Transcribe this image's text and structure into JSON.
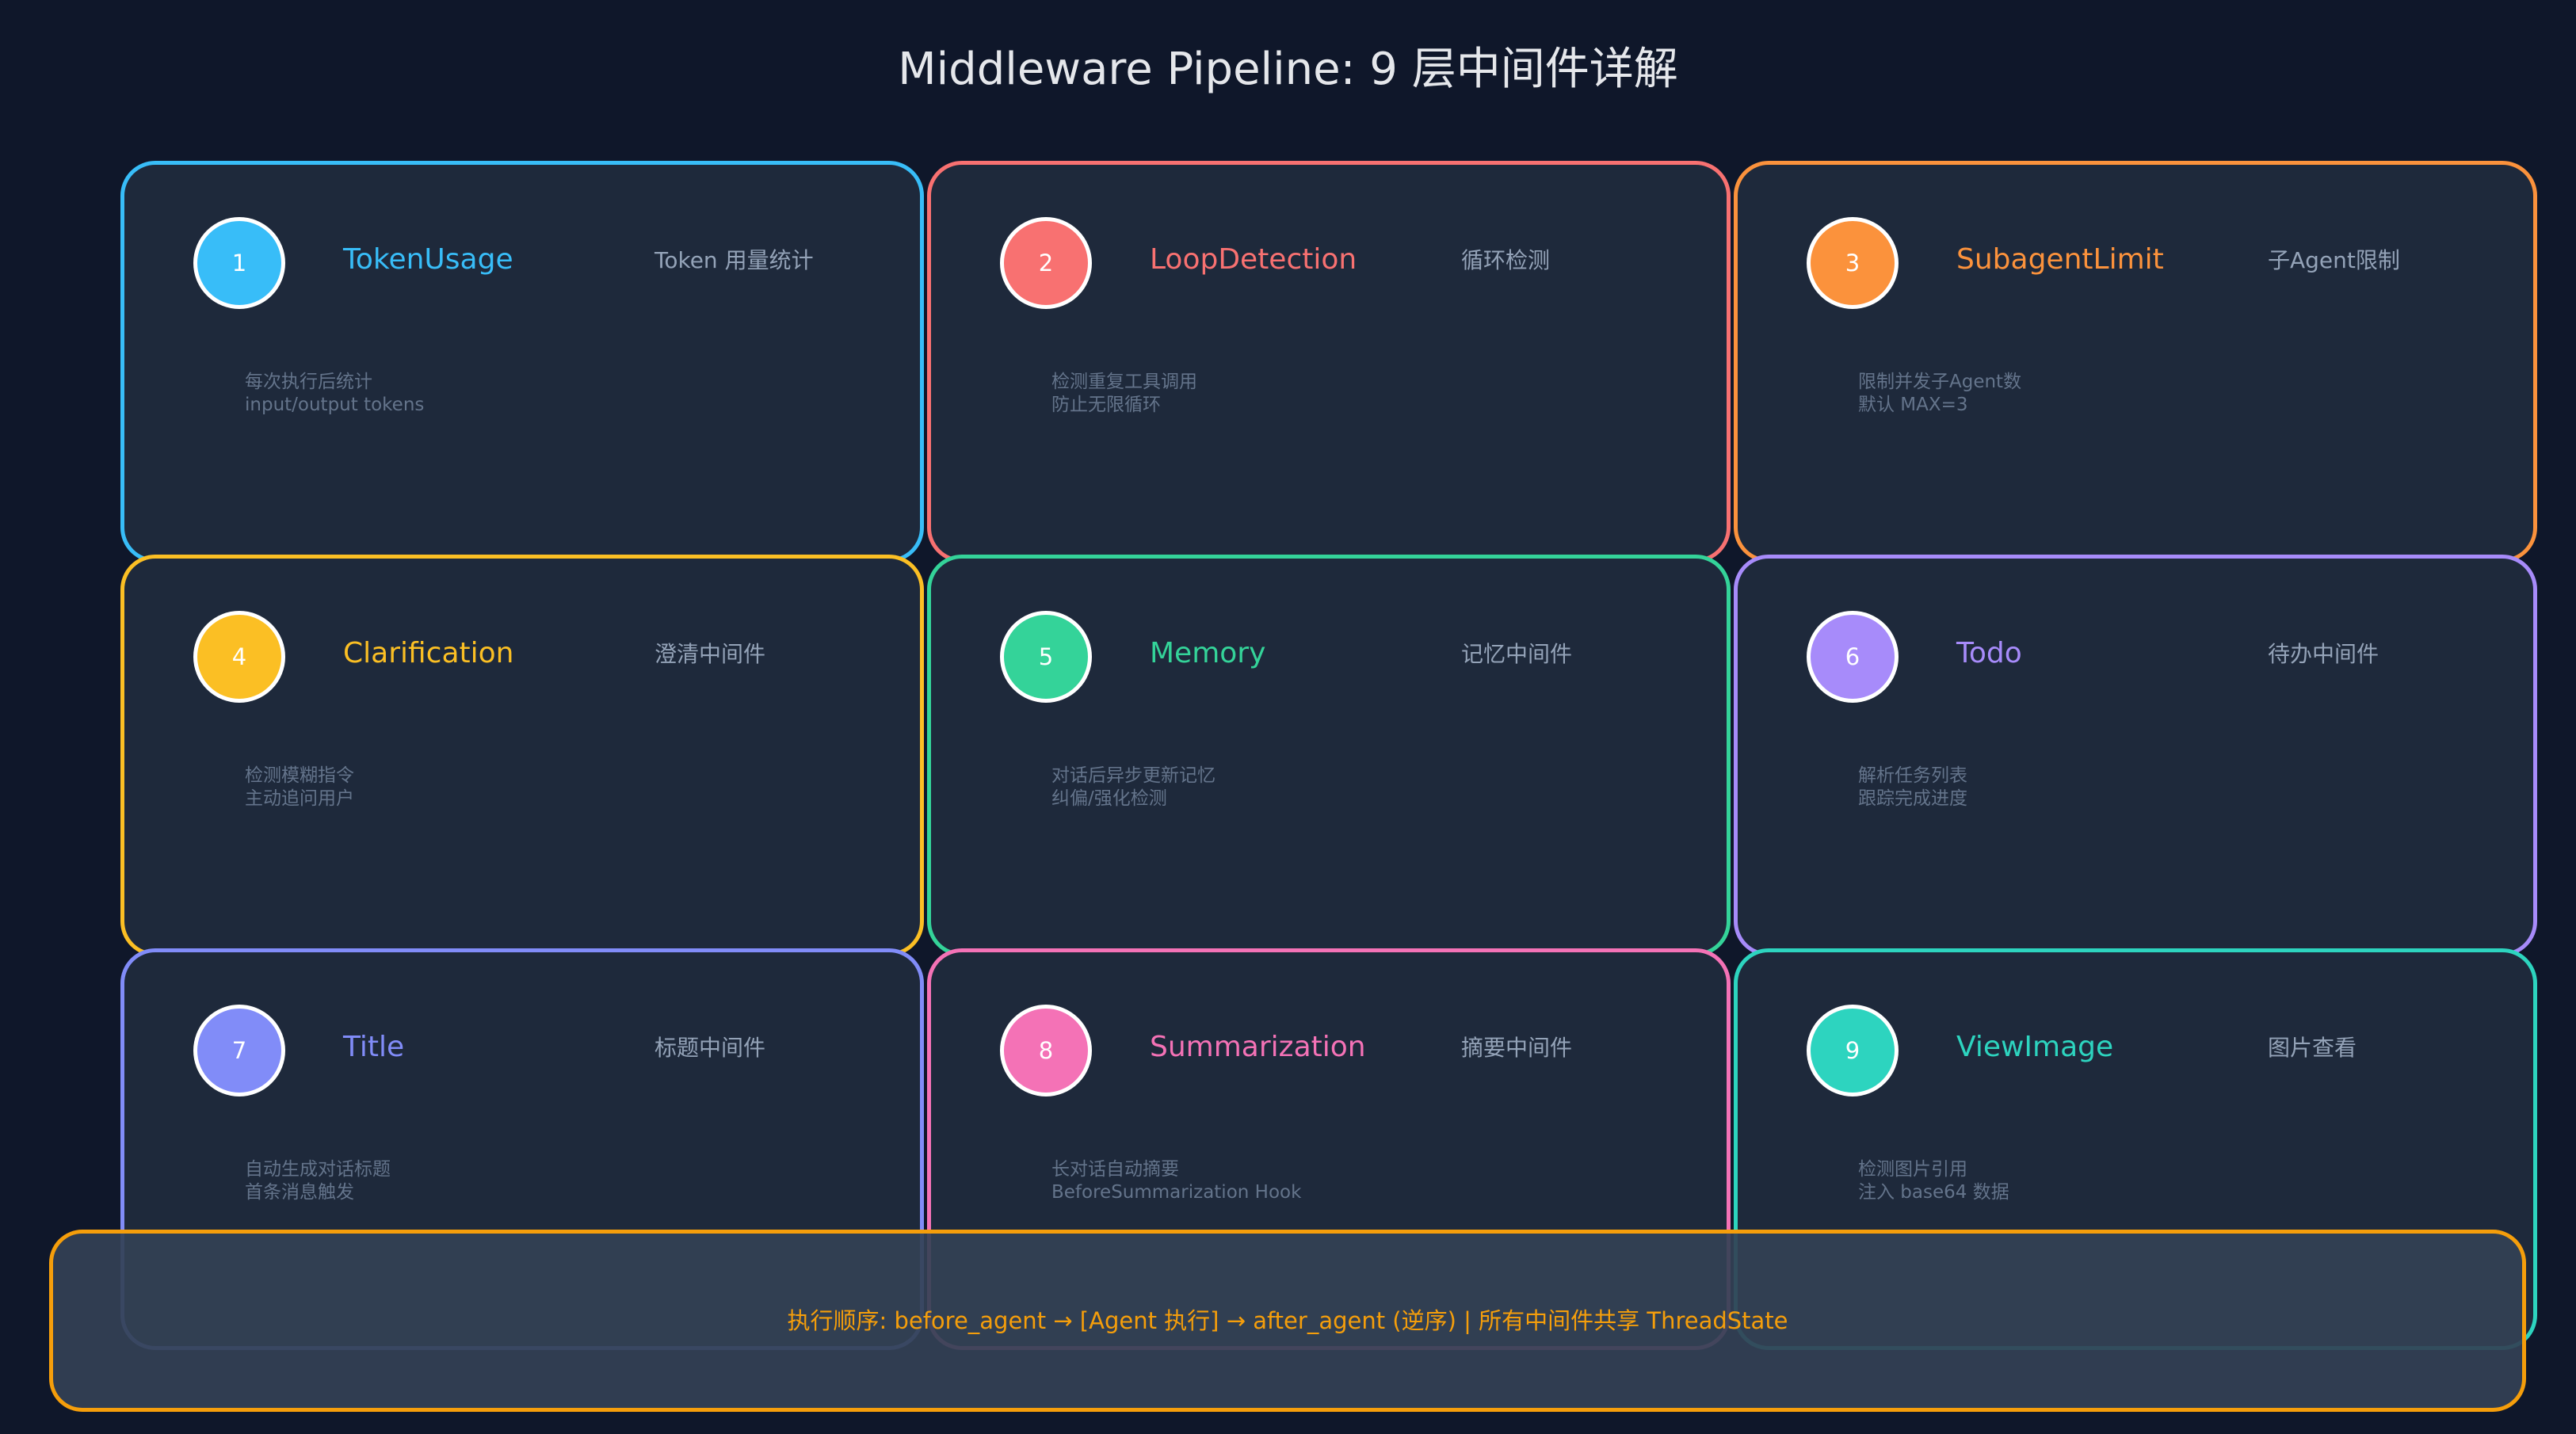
{
  "title": "Middleware Pipeline: 9 层中间件详解",
  "cards": [
    {
      "number": "1",
      "name": "TokenUsage",
      "cn": "Token 用量统计",
      "desc": [
        "每次执行后统计",
        "input/output tokens"
      ],
      "color": "#38bdf8"
    },
    {
      "number": "2",
      "name": "LoopDetection",
      "cn": "循环检测",
      "desc": [
        "检测重复工具调用",
        "防止无限循环"
      ],
      "color": "#f87171"
    },
    {
      "number": "3",
      "name": "SubagentLimit",
      "cn": "子Agent限制",
      "desc": [
        "限制并发子Agent数",
        "默认 MAX=3"
      ],
      "color": "#fb923c"
    },
    {
      "number": "4",
      "name": "Clarification",
      "cn": "澄清中间件",
      "desc": [
        "检测模糊指令",
        "主动追问用户"
      ],
      "color": "#fbbf24"
    },
    {
      "number": "5",
      "name": "Memory",
      "cn": "记忆中间件",
      "desc": [
        "对话后异步更新记忆",
        "纠偏/强化检测"
      ],
      "color": "#34d399"
    },
    {
      "number": "6",
      "name": "Todo",
      "cn": "待办中间件",
      "desc": [
        "解析任务列表",
        "跟踪完成进度"
      ],
      "color": "#a78bfa"
    },
    {
      "number": "7",
      "name": "Title",
      "cn": "标题中间件",
      "desc": [
        "自动生成对话标题",
        "首条消息触发"
      ],
      "color": "#818cf8"
    },
    {
      "number": "8",
      "name": "Summarization",
      "cn": "摘要中间件",
      "desc": [
        "长对话自动摘要",
        "BeforeSummarization Hook"
      ],
      "color": "#f472b6"
    },
    {
      "number": "9",
      "name": "ViewImage",
      "cn": "图片查看",
      "desc": [
        "检测图片引用",
        "注入 base64 数据"
      ],
      "color": "#2dd4bf"
    }
  ],
  "footer": {
    "text": "执行顺序: before_agent → [Agent 执行] → after_agent (逆序)  |  所有中间件共享 ThreadState",
    "color": "#f59e0b"
  }
}
